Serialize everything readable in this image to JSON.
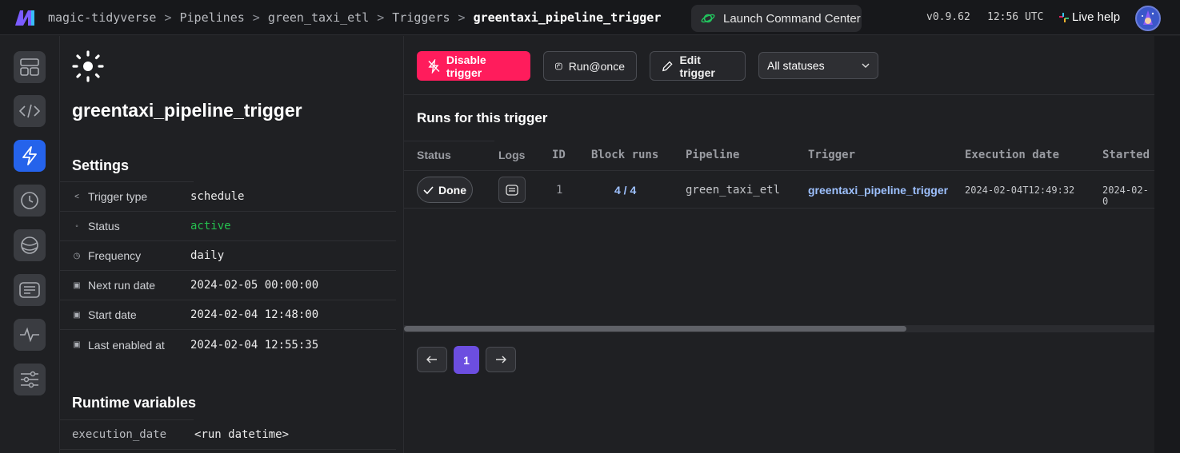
{
  "header": {
    "breadcrumbs": [
      "magic-tidyverse",
      "Pipelines",
      "green_taxi_etl",
      "Triggers",
      "greentaxi_pipeline_trigger"
    ],
    "separator": ">",
    "launch_label": "Launch Command Center",
    "version": "v0.9.62",
    "time": "12:56 UTC",
    "help_label": "Live help"
  },
  "rail": {
    "items": [
      "layout-icon",
      "code-icon",
      "lightning-icon",
      "clock-icon",
      "globe-icon",
      "logs-icon",
      "pulse-icon",
      "sliders-icon"
    ],
    "active": "lightning-icon"
  },
  "panel": {
    "title": "greentaxi_pipeline_trigger",
    "settings_title": "Settings",
    "settings": [
      {
        "label": "Trigger type",
        "value": "schedule"
      },
      {
        "label": "Status",
        "value": "active"
      },
      {
        "label": "Frequency",
        "value": "daily"
      },
      {
        "label": "Next run date",
        "value": "2024-02-05 00:00:00"
      },
      {
        "label": "Start date",
        "value": "2024-02-04 12:48:00"
      },
      {
        "label": "Last enabled at",
        "value": "2024-02-04 12:55:35"
      }
    ],
    "runtime_title": "Runtime variables",
    "runtime": [
      {
        "label": "execution_date",
        "value": "<run datetime>"
      }
    ]
  },
  "toolbar": {
    "disable_label": "Disable trigger",
    "run_once_label": "Run@once",
    "edit_label": "Edit trigger",
    "status_filter": "All statuses"
  },
  "runs": {
    "title": "Runs for this trigger",
    "columns": [
      "Status",
      "Logs",
      "ID",
      "Block runs",
      "Pipeline",
      "Trigger",
      "Execution date",
      "Started"
    ],
    "rows": [
      {
        "status": "Done",
        "id": "1",
        "block_runs": "4 / 4",
        "pipeline": "green_taxi_etl",
        "trigger": "greentaxi_pipeline_trigger",
        "execution_date": "2024-02-04T12:49:32",
        "started": "2024-02-0"
      }
    ],
    "page": "1"
  },
  "colors": {
    "accent_danger": "#ff1c5c",
    "active_green": "#25c04f",
    "link_blue": "#9ec1ff",
    "page_purple": "#6c4ee0",
    "rail_active": "#2563eb"
  }
}
